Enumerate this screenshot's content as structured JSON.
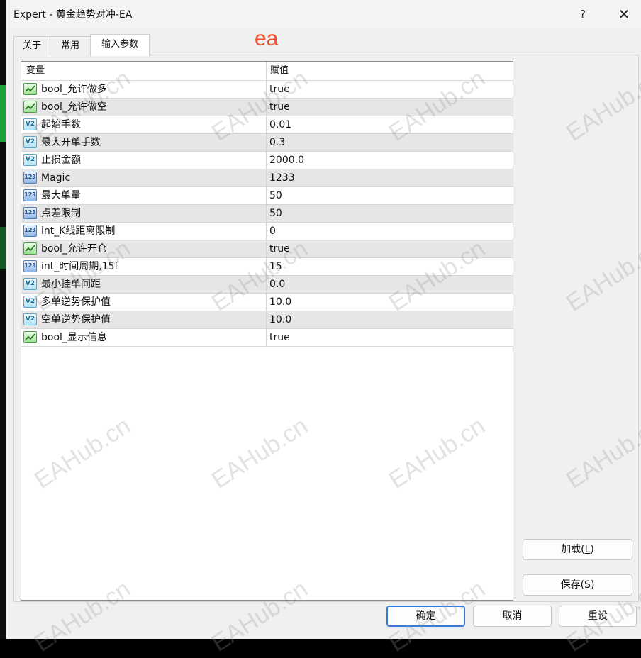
{
  "window": {
    "title": "Expert - 黄金趋势对冲-EA",
    "help_glyph": "?",
    "close_glyph": "✕"
  },
  "overlay_text": "ea",
  "tabs": [
    {
      "label": "关于",
      "active": false
    },
    {
      "label": "常用",
      "active": false
    },
    {
      "label": "输入参数",
      "active": true
    }
  ],
  "grid": {
    "columns": [
      "变量",
      "赋值"
    ],
    "rows": [
      {
        "icon": "bool-icon",
        "name": "bool_允许做多",
        "value": "true"
      },
      {
        "icon": "bool-icon",
        "name": "bool_允许做空",
        "value": "true"
      },
      {
        "icon": "double-icon",
        "name": "起始手数",
        "value": "0.01"
      },
      {
        "icon": "double-icon",
        "name": "最大开单手数",
        "value": "0.3"
      },
      {
        "icon": "double-icon",
        "name": "止损金额",
        "value": "2000.0"
      },
      {
        "icon": "int-icon",
        "name": "Magic",
        "value": "1233"
      },
      {
        "icon": "int-icon",
        "name": "最大单量",
        "value": "50"
      },
      {
        "icon": "int-icon",
        "name": "点差限制",
        "value": "50"
      },
      {
        "icon": "int-icon",
        "name": "int_K线距离限制",
        "value": "0"
      },
      {
        "icon": "bool-icon",
        "name": "bool_允许开仓",
        "value": "true"
      },
      {
        "icon": "int-icon",
        "name": "int_时间周期,15f",
        "value": "15"
      },
      {
        "icon": "double-icon",
        "name": "最小挂单间距",
        "value": "0.0"
      },
      {
        "icon": "double-icon",
        "name": "多单逆势保护值",
        "value": "10.0"
      },
      {
        "icon": "double-icon",
        "name": "空单逆势保护值",
        "value": "10.0"
      },
      {
        "icon": "bool-icon",
        "name": "bool_显示信息",
        "value": "true"
      }
    ]
  },
  "buttons": {
    "load": {
      "label": "加载(",
      "mnemonic": "L",
      "suffix": ")"
    },
    "save": {
      "label": "保存(",
      "mnemonic": "S",
      "suffix": ")"
    },
    "ok": "确定",
    "cancel": "取消",
    "reset": "重设"
  },
  "watermark_text": "EAHub.cn",
  "colors": {
    "overlay_text": "#ef4f2a",
    "primary_button_border": "#3a78d6",
    "row_alt": "#e6e6e6"
  }
}
